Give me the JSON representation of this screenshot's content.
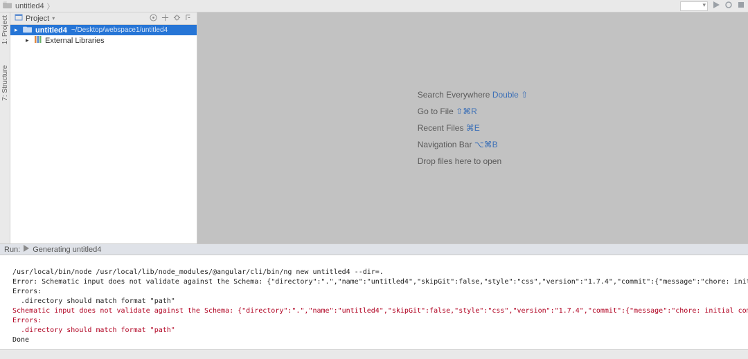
{
  "breadcrumb": {
    "project": "untitled4"
  },
  "sidebar_tabs": {
    "project": "1: Project",
    "structure": "7: Structure"
  },
  "project_pane": {
    "title": "Project",
    "root_name": "untitled4",
    "root_path": "~/Desktop/webspace1/untitled4",
    "external_libs": "External Libraries"
  },
  "editor_hints": {
    "search_label": "Search Everywhere",
    "search_shortcut": "Double ⇧",
    "goto_label": "Go to File",
    "goto_shortcut": "⇧⌘R",
    "recent_label": "Recent Files",
    "recent_shortcut": "⌘E",
    "navbar_label": "Navigation Bar",
    "navbar_shortcut": "⌥⌘B",
    "drop_label": "Drop files here to open"
  },
  "run_bar": {
    "label": "Run:",
    "task": "Generating untitled4"
  },
  "console": {
    "line1": "/usr/local/bin/node /usr/local/lib/node_modules/@angular/cli/bin/ng new untitled4 --dir=.",
    "line2": "Error: Schematic input does not validate against the Schema: {\"directory\":\".\",\"name\":\"untitled4\",\"skipGit\":false,\"style\":\"css\",\"version\":\"1.7.4\",\"commit\":{\"message\":\"chore: initial commit from @angular/cli\\n\\n    _",
    "line3": "Errors:",
    "line4": "  .directory should match format \"path\"",
    "line5": "Schematic input does not validate against the Schema: {\"directory\":\".\",\"name\":\"untitled4\",\"skipGit\":false,\"style\":\"css\",\"version\":\"1.7.4\",\"commit\":{\"message\":\"chore: initial commit from @angular/cli\\n\\n    _",
    "line6": "Errors:",
    "line7": "  .directory should match format \"path\"",
    "line8": "Done"
  }
}
